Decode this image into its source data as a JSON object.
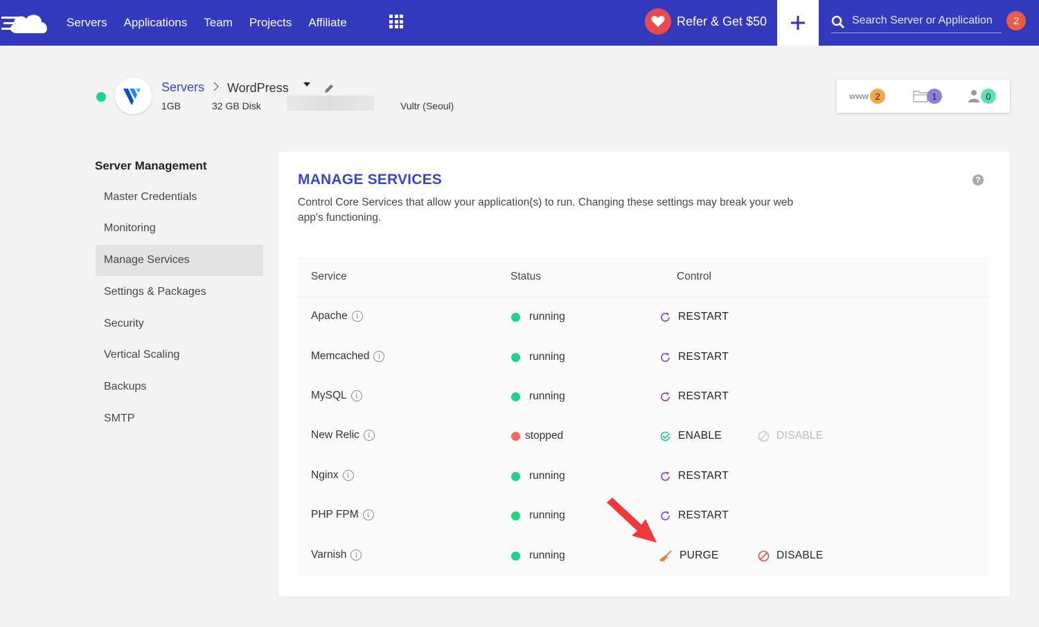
{
  "nav": {
    "items": [
      {
        "name": "nav-servers",
        "label": "Servers"
      },
      {
        "name": "nav-applications",
        "label": "Applications"
      },
      {
        "name": "nav-team",
        "label": "Team"
      },
      {
        "name": "nav-projects",
        "label": "Projects"
      },
      {
        "name": "nav-affiliate",
        "label": "Affiliate"
      }
    ],
    "refer_label": "Refer & Get $50",
    "search_placeholder": "Search Server or Application",
    "notification_count": "2"
  },
  "server": {
    "breadcrumb_parent": "Servers",
    "name": "WordPress",
    "ram": "1GB",
    "disk": "32 GB Disk",
    "provider": "Vultr (Seoul)",
    "counts": {
      "apps": "2",
      "files": "1",
      "users": "0"
    },
    "www_label": "www"
  },
  "sidebar": {
    "title": "Server Management",
    "items": [
      {
        "label": "Master Credentials",
        "active": false
      },
      {
        "label": "Monitoring",
        "active": false
      },
      {
        "label": "Manage Services",
        "active": true
      },
      {
        "label": "Settings & Packages",
        "active": false
      },
      {
        "label": "Security",
        "active": false
      },
      {
        "label": "Vertical Scaling",
        "active": false
      },
      {
        "label": "Backups",
        "active": false
      },
      {
        "label": "SMTP",
        "active": false
      }
    ]
  },
  "panel": {
    "title": "MANAGE SERVICES",
    "description": "Control Core Services that allow your application(s) to run. Changing these settings may break your web app's functioning.",
    "help": "?",
    "columns": {
      "service": "Service",
      "status": "Status",
      "control": "Control"
    },
    "services": [
      {
        "name": "Apache",
        "status": "running",
        "controls": [
          {
            "label": "RESTART",
            "icon": "restart"
          }
        ]
      },
      {
        "name": "Memcached",
        "status": "running",
        "controls": [
          {
            "label": "RESTART",
            "icon": "restart"
          }
        ]
      },
      {
        "name": "MySQL",
        "status": "running",
        "controls": [
          {
            "label": "RESTART",
            "icon": "restart"
          }
        ]
      },
      {
        "name": "New Relic",
        "status": "stopped",
        "controls": [
          {
            "label": "ENABLE",
            "icon": "enable"
          },
          {
            "label": "DISABLE",
            "icon": "disable-muted"
          }
        ]
      },
      {
        "name": "Nginx",
        "status": "running",
        "controls": [
          {
            "label": "RESTART",
            "icon": "restart"
          }
        ]
      },
      {
        "name": "PHP FPM",
        "status": "running",
        "controls": [
          {
            "label": "RESTART",
            "icon": "restart"
          }
        ]
      },
      {
        "name": "Varnish",
        "status": "running",
        "controls": [
          {
            "label": "PURGE",
            "icon": "purge"
          },
          {
            "label": "DISABLE",
            "icon": "disable"
          }
        ]
      }
    ]
  },
  "colors": {
    "topbar": "#3339bb",
    "accent": "#3a47c5",
    "running": "#1ed38a",
    "stopped": "#f26b61",
    "restart_icon": "#8a4fd1",
    "enable_icon": "#1ec98b",
    "disable_icon": "#e94b4b",
    "purge_icon": "#ef7d3c",
    "arrow": "#ee3a3a"
  }
}
